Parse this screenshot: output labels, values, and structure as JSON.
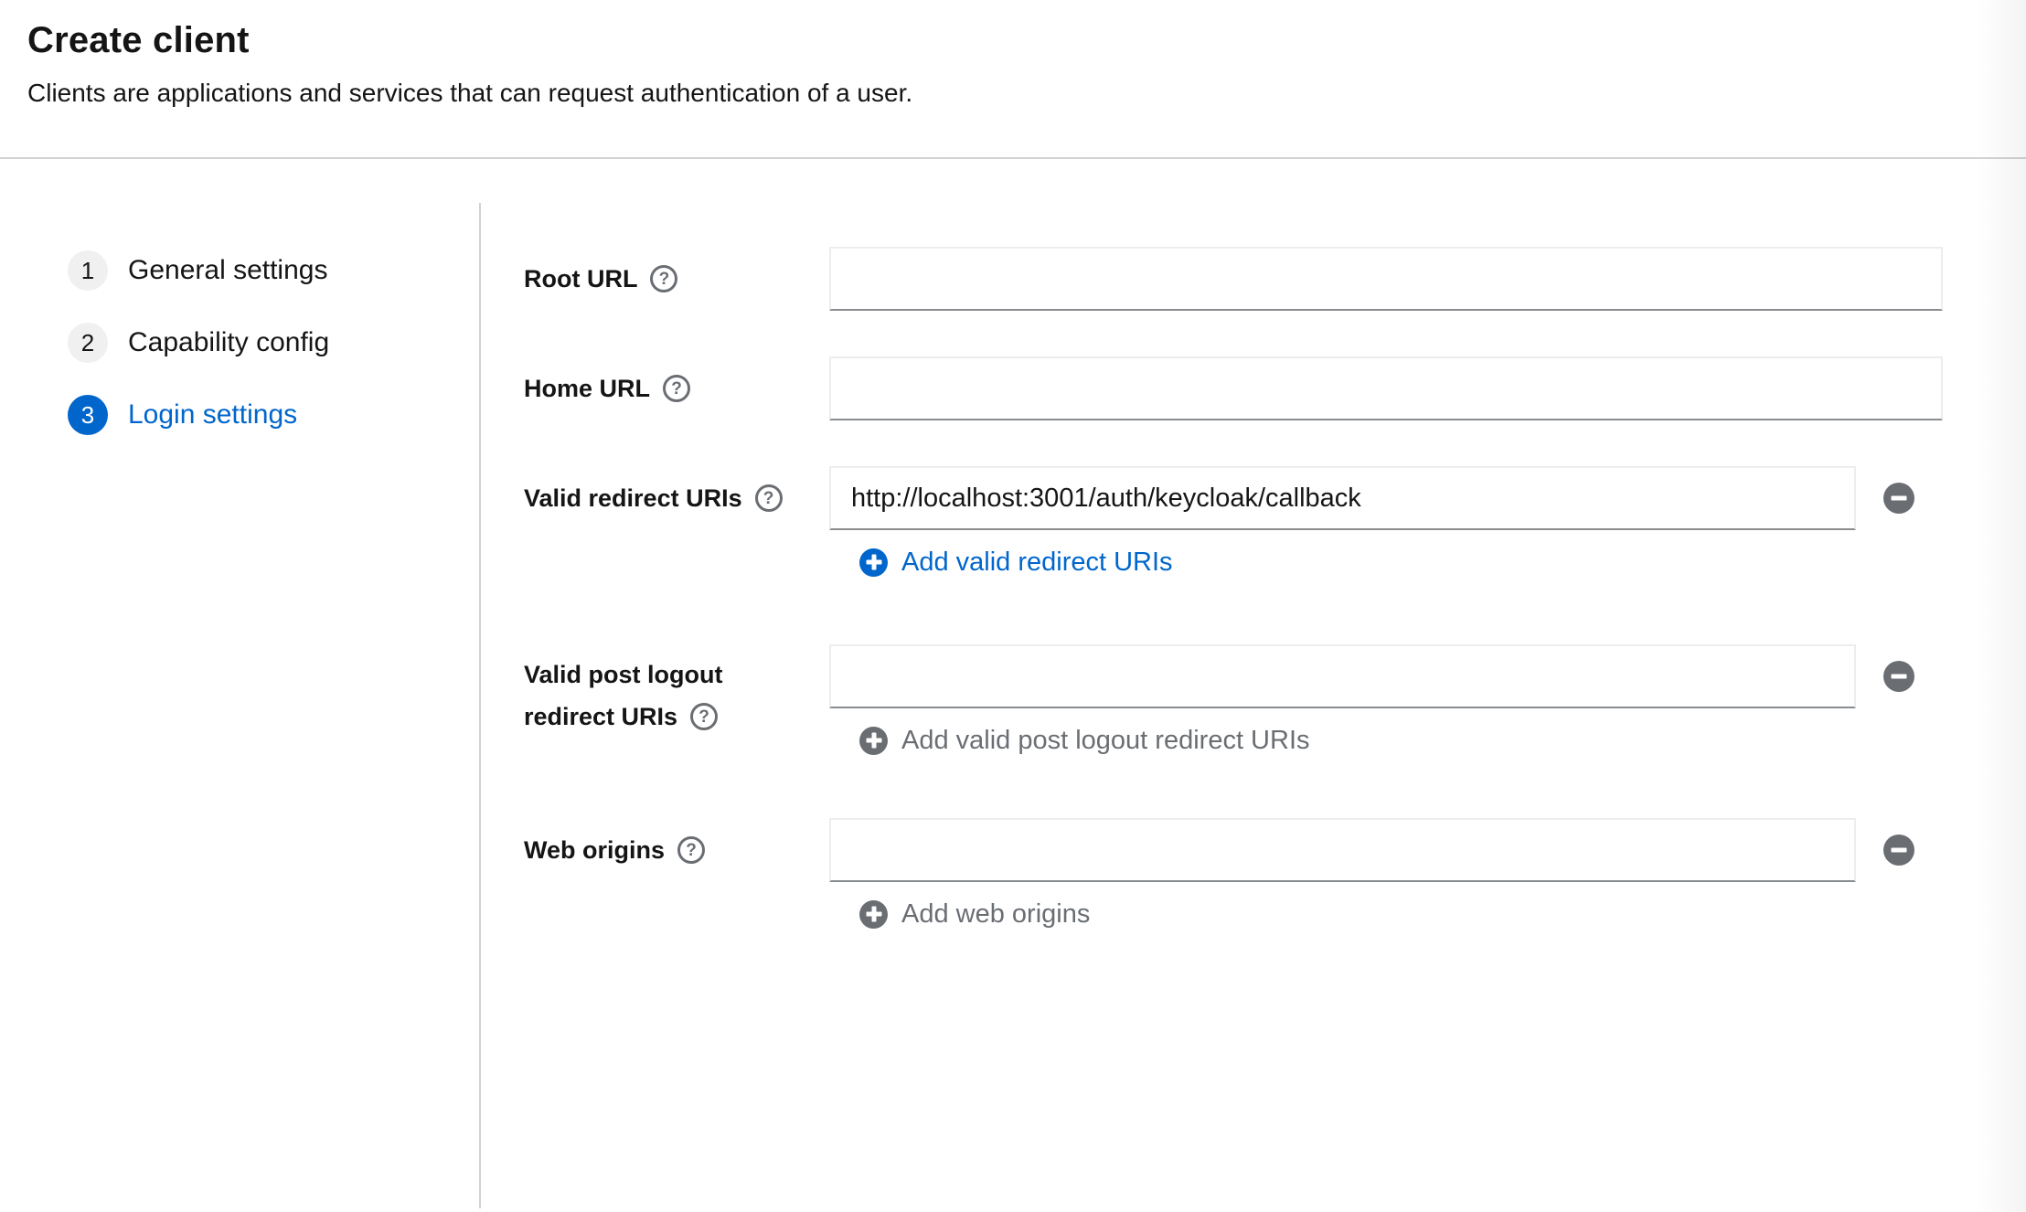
{
  "header": {
    "title": "Create client",
    "subtitle": "Clients are applications and services that can request authentication of a user."
  },
  "wizard": {
    "active_step_number": "3",
    "steps": [
      {
        "number": "1",
        "label": "General settings"
      },
      {
        "number": "2",
        "label": "Capability config"
      },
      {
        "number": "3",
        "label": "Login settings"
      }
    ]
  },
  "form": {
    "root_url": {
      "label": "Root URL",
      "value": ""
    },
    "home_url": {
      "label": "Home URL",
      "value": ""
    },
    "valid_redirect_uris": {
      "label": "Valid redirect URIs",
      "value": "http://localhost:3001/auth/keycloak/callback",
      "add_label": "Add valid redirect URIs"
    },
    "valid_post_logout_redirect_uris": {
      "label_line1": "Valid post logout",
      "label_line2": "redirect URIs",
      "value": "",
      "add_label": "Add valid post logout redirect URIs"
    },
    "web_origins": {
      "label": "Web origins",
      "value": "",
      "add_label": "Add web origins"
    }
  },
  "icons": {
    "help_glyph": "?"
  },
  "colors": {
    "accent_blue": "#0066cc",
    "icon_gray": "#6a6e73",
    "step_inactive_bg": "#f0f0f0",
    "divider": "#d2d2d2",
    "input_border_bottom": "#8a8d90"
  }
}
